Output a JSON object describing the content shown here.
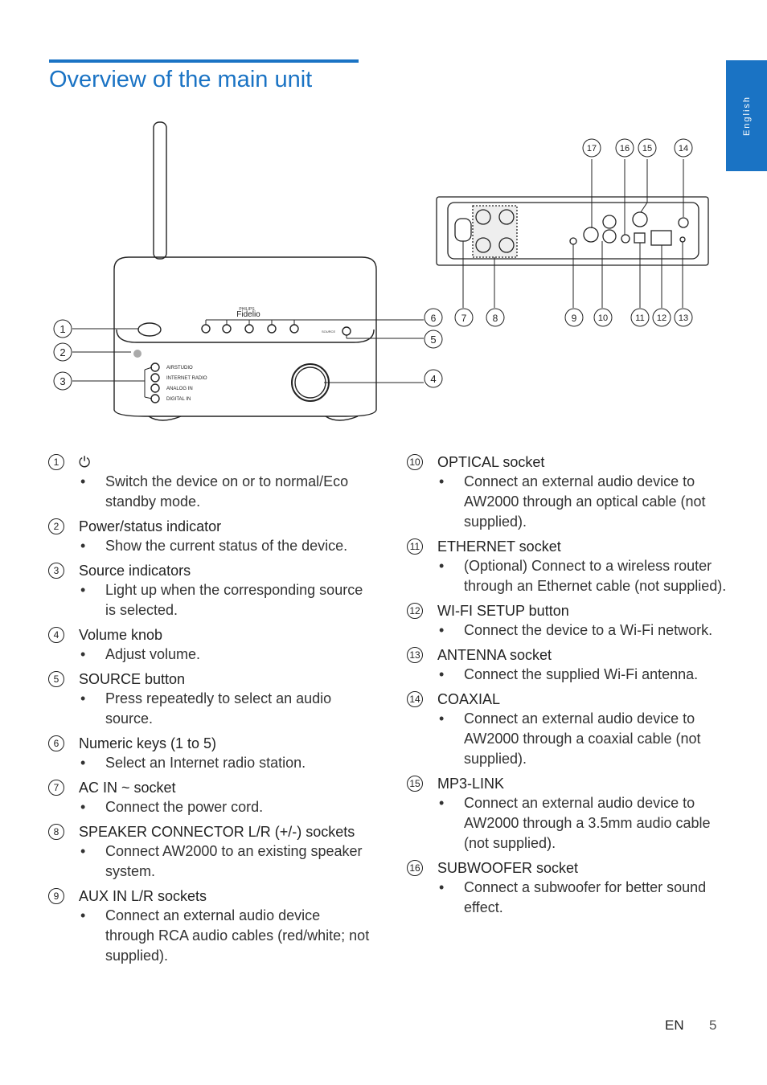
{
  "page": {
    "title": "Overview of the main unit",
    "language_tab": "English",
    "footer": {
      "lang": "EN",
      "page_number": "5"
    },
    "accent_color": "#1a73c4"
  },
  "diagram": {
    "front_labels": [
      "1",
      "2",
      "3",
      "4",
      "5",
      "6"
    ],
    "rear_bottom_labels": [
      "6",
      "7",
      "8",
      "9",
      "10",
      "11",
      "12",
      "13"
    ],
    "rear_top_labels": [
      "17",
      "16",
      "15",
      "14"
    ],
    "brand_small": "PHILIPS",
    "brand": "Fidelio",
    "source_label": "SOURCE",
    "source_indicators": [
      "AIRSTUDIO",
      "INTERNET RADIO",
      "ANALOG IN",
      "DIGITAL IN"
    ],
    "rear_port_labels": [
      "SUBWOOFER",
      "MP3 LINK",
      "COAXIAL",
      "OPTICAL",
      "ETHERNET",
      "ANTENNA",
      "WIFI SETUP",
      "AC IN",
      "SPEAKER CONNECTOR"
    ]
  },
  "left_items": [
    {
      "num": "1",
      "title": "⏻",
      "bullets": [
        "Switch the device on or to normal/Eco standby mode."
      ]
    },
    {
      "num": "2",
      "title": "Power/status indicator",
      "bullets": [
        "Show the current status of the device."
      ]
    },
    {
      "num": "3",
      "title": "Source indicators",
      "bullets": [
        "Light up when the corresponding source is selected."
      ]
    },
    {
      "num": "4",
      "title": "Volume knob",
      "bullets": [
        "Adjust volume."
      ]
    },
    {
      "num": "5",
      "title": "SOURCE button",
      "bullets": [
        "Press repeatedly to select an audio source."
      ]
    },
    {
      "num": "6",
      "title": "Numeric keys (1 to 5)",
      "bullets": [
        "Select an Internet radio station."
      ]
    },
    {
      "num": "7",
      "title": "AC IN ~ socket",
      "bullets": [
        "Connect the power cord."
      ]
    },
    {
      "num": "8",
      "title": "SPEAKER CONNECTOR L/R (+/-) sockets",
      "bullets": [
        "Connect AW2000 to an existing speaker system."
      ]
    },
    {
      "num": "9",
      "title": "AUX IN L/R sockets",
      "bullets": [
        "Connect an external audio device through RCA audio cables (red/white; not supplied)."
      ]
    }
  ],
  "right_items": [
    {
      "num": "10",
      "title": "OPTICAL socket",
      "bullets": [
        "Connect an external audio device to AW2000 through an optical cable (not supplied)."
      ]
    },
    {
      "num": "11",
      "title": "ETHERNET socket",
      "bullets": [
        "(Optional) Connect to a wireless router through an Ethernet cable (not supplied)."
      ]
    },
    {
      "num": "12",
      "title": "WI-FI SETUP button",
      "bullets": [
        "Connect the device to a Wi-Fi network."
      ]
    },
    {
      "num": "13",
      "title": "ANTENNA socket",
      "bullets": [
        "Connect the supplied Wi-Fi antenna."
      ]
    },
    {
      "num": "14",
      "title": "COAXIAL",
      "bullets": [
        "Connect an external audio device to AW2000 through a coaxial cable (not supplied)."
      ]
    },
    {
      "num": "15",
      "title": "MP3-LINK",
      "bullets": [
        "Connect an external audio device to AW2000 through a 3.5mm audio cable (not supplied)."
      ]
    },
    {
      "num": "16",
      "title": "SUBWOOFER socket",
      "bullets": [
        "Connect a subwoofer for better sound effect."
      ]
    }
  ]
}
